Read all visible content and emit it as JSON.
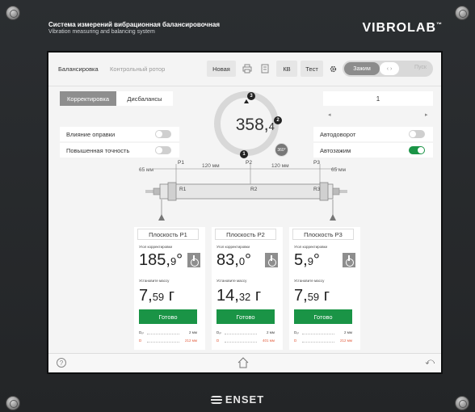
{
  "device": {
    "title": "Система измерений вибрационная балансировочная",
    "subtitle": "Vibration measuring and balancing system",
    "logo": "VIBROLAB",
    "logo_tm": "™",
    "maker": "ENSET"
  },
  "topbar": {
    "tabs": [
      "Балансировка",
      "Контрольный ротор"
    ],
    "new_label": "Новая",
    "kv_label": "КВ",
    "test_label": "Тест",
    "toggle": {
      "left": "Зажим",
      "knob": "‹ ›",
      "right": "Пуск"
    }
  },
  "segments": {
    "correction": "Корректировка",
    "imbalances": "Дисбалансы"
  },
  "options": [
    {
      "label": "Влияние оправки",
      "on": false
    },
    {
      "label": "Повышенная точность",
      "on": false
    }
  ],
  "right_options": [
    {
      "label": "Автодоворот",
      "on": false
    },
    {
      "label": "Автозажим",
      "on": true
    }
  ],
  "selector_value": "1",
  "selector_arrows": {
    "left": "◂",
    "right": "▸"
  },
  "angle": {
    "int": "358,",
    "frac": "4",
    "unit": "°"
  },
  "markers": [
    "1",
    "2",
    "3"
  ],
  "badge_360": "360°",
  "rotor": {
    "left_dim": "65 мм",
    "right_dim": "65 мм",
    "gap1": "120 мм",
    "gap2": "120 мм",
    "planes_top": [
      "P1",
      "P2",
      "P3"
    ],
    "planes_in": [
      "R1",
      "R2",
      "R3"
    ]
  },
  "panels": [
    {
      "title": "Плоскость P1",
      "angle_cap": "Угол корректировки",
      "angle_int": "185,",
      "angle_frac": "9",
      "angle_unit": "°",
      "mass_cap": "Установите массу",
      "mass_int": "7,",
      "mass_frac": "59",
      "mass_unit": " г",
      "button": "Готово",
      "foot1_l": "Dₒₗ",
      "foot1_r": "2 мм",
      "foot2_l": "D",
      "foot2_r": "212 мм"
    },
    {
      "title": "Плоскость P2",
      "angle_cap": "Угол корректировки",
      "angle_int": "83,",
      "angle_frac": "0",
      "angle_unit": "°",
      "mass_cap": "Установите массу",
      "mass_int": "14,",
      "mass_frac": "32",
      "mass_unit": " г",
      "button": "Готово",
      "foot1_l": "Dₒₗ",
      "foot1_r": "2 мм",
      "foot2_l": "D",
      "foot2_r": "401 мм"
    },
    {
      "title": "Плоскость P3",
      "angle_cap": "Угол корректировки",
      "angle_int": "5,",
      "angle_frac": "9",
      "angle_unit": "°",
      "mass_cap": "Установите массу",
      "mass_int": "7,",
      "mass_frac": "59",
      "mass_unit": " г",
      "button": "Готово",
      "foot1_l": "Dₒₗ",
      "foot1_r": "2 мм",
      "foot2_l": "D",
      "foot2_r": "212 мм"
    }
  ],
  "bottombar": {
    "help": "?",
    "back": "⤺"
  },
  "colors": {
    "accent": "#1a9446",
    "foot_red": "#e25c3d",
    "panel_bg": "#8e8e8e"
  }
}
